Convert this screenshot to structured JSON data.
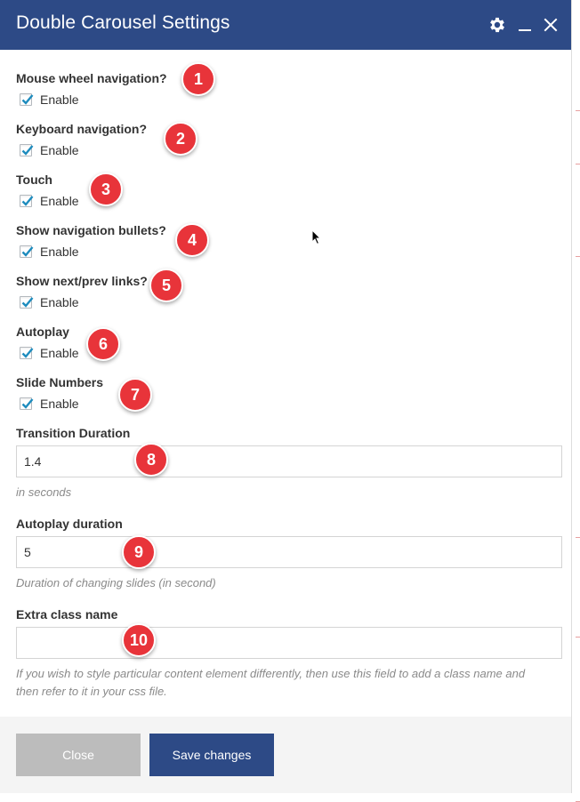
{
  "dialog": {
    "title": "Double Carousel Settings",
    "controls": {
      "settings_icon": "gear-icon",
      "minimize_icon": "minimize-icon",
      "close_icon": "close-icon"
    }
  },
  "fields": {
    "mouse_wheel": {
      "label": "Mouse wheel navigation?",
      "checkbox_label": "Enable",
      "checked": true,
      "badge": "1"
    },
    "keyboard": {
      "label": "Keyboard navigation?",
      "checkbox_label": "Enable",
      "checked": true,
      "badge": "2"
    },
    "touch": {
      "label": "Touch",
      "checkbox_label": "Enable",
      "checked": true,
      "badge": "3"
    },
    "bullets": {
      "label": "Show navigation bullets?",
      "checkbox_label": "Enable",
      "checked": true,
      "badge": "4"
    },
    "next_prev": {
      "label": "Show next/prev links?",
      "checkbox_label": "Enable",
      "checked": true,
      "badge": "5"
    },
    "autoplay": {
      "label": "Autoplay",
      "checkbox_label": "Enable",
      "checked": true,
      "badge": "6"
    },
    "slide_numbers": {
      "label": "Slide Numbers",
      "checkbox_label": "Enable",
      "checked": true,
      "badge": "7"
    },
    "transition_duration": {
      "label": "Transition Duration",
      "value": "1.4",
      "hint": "in seconds",
      "badge": "8"
    },
    "autoplay_duration": {
      "label": "Autoplay duration",
      "value": "5",
      "hint": "Duration of changing slides (in second)",
      "badge": "9"
    },
    "extra_class": {
      "label": "Extra class name",
      "value": "",
      "hint": "If you wish to style particular content element differently, then use this field to add a class name and then refer to it in your css file.",
      "badge": "10"
    }
  },
  "footer": {
    "close_label": "Close",
    "save_label": "Save changes"
  },
  "colors": {
    "titlebar": "#2d4a86",
    "badge": "#e8343a",
    "save_button": "#2d4a86",
    "close_button": "#bcbcbc",
    "checkmark": "#1e8cbe"
  }
}
